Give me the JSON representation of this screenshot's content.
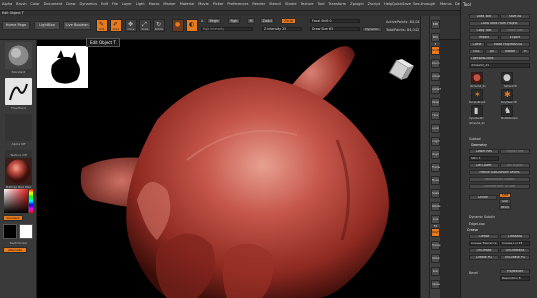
{
  "menubar": {
    "items": [
      "Alpha",
      "Brush",
      "Color",
      "Document",
      "Draw",
      "Dynamics",
      "Edit",
      "File",
      "Layer",
      "Light",
      "Macro",
      "Marker",
      "Material",
      "Movie",
      "Picker",
      "Preferences",
      "Render",
      "Stencil",
      "Stroke",
      "Texture",
      "Tool",
      "Transform",
      "Zplugin",
      "Zscript",
      "Help"
    ],
    "right": [
      "QuickSave",
      "See-through",
      "Menus",
      "DefaultZScript"
    ]
  },
  "subbar": {
    "position": "Edit Object T"
  },
  "shelf": {
    "home_page": "Home Page",
    "lightbox": "LightBox",
    "live_boolean": "Live Boolean",
    "edit": "Edit",
    "draw": "Draw",
    "move": "Move",
    "scale": "Scale",
    "rotate": "Rotate",
    "a_label": "A",
    "mrgb": "Mrgb",
    "rgb": "Rgb",
    "m": "M",
    "rgb_intensity": "Rgb Intensity",
    "zadd": "Zadd",
    "zsub": "Zsub",
    "z_intensity": "Z Intensity 25",
    "focal_shift": "Focal Shift 0",
    "draw_size": "Draw Size 63",
    "dynamic": "Dynamic",
    "active_points": "ActivePoints: 84,042",
    "total_points": "TotalPoints: 84,042"
  },
  "left": {
    "brush_name": "Standard",
    "stroke_name": "FreeHand",
    "alpha_name": "Alpha Off",
    "texture_name": "Texture Off",
    "material_name": "MatCap Red Wax",
    "gradient": "Gradient",
    "switch_color": "SwitchColor",
    "alternate": "Alternate"
  },
  "tooltip": "Edit Object  T",
  "rightstrip": {
    "buttons": [
      "BPR",
      "SPix 3",
      "Scroll",
      "Zoom",
      "Actual",
      "AAHalf",
      "Persp",
      "Floor",
      "Local",
      "L.Sym",
      "Gxyz",
      "Frame",
      "Move",
      "Scale",
      "Rotate",
      "Line Fill",
      "PolyF",
      "Transp",
      "Ghost",
      "Solo",
      "Xpose"
    ]
  },
  "palette": {
    "title": "Tool",
    "row1": [
      "Load Tool",
      "Save As"
    ],
    "row2": [
      "Load Tools From Project"
    ],
    "row3": [
      "Copy Tool",
      "Paste Tool"
    ],
    "row4": [
      "Import",
      "Export"
    ],
    "row5": [
      "Clone",
      "Make PolyMesh3D"
    ],
    "row6": [
      "GoZ",
      "All",
      "Visible",
      "R"
    ],
    "lightbox_tools": "Lightbox▸Tools",
    "dynamesh_slider": "dimesh2_41",
    "slot_names": [
      "dimesh2_41",
      "Sphere3D",
      "SimpleBrush",
      "PolyMesh3D",
      "Cylinder3D",
      "MultiMarkers",
      "dimesh2_41"
    ],
    "subtool": "Subtool",
    "geometry": "Geometry",
    "lower_res": "Lower Res",
    "higher_res": "Higher Res",
    "sdiv": "SDiv 1",
    "del_lower": "Del Lower",
    "del_higher": "Del Higher",
    "freeze": "Freeze SubDivision Levels",
    "reconstruct": "Reconstruct Subdiv",
    "convert_bpr": "Convert BPR To Geo",
    "divide": "Divide",
    "smt": "Smt",
    "suv": "Suv",
    "reuv": "ReUV",
    "dynamic_subdiv": "Dynamic Subdiv",
    "edgeloop": "EdgeLoop",
    "crease": "Crease",
    "crease_btn": "Crease",
    "crease_all": "CreaseAll",
    "crease_tol": "Crease Tolerance 45",
    "crease_lvl": "Crease Lvl 15",
    "uncrease": "UnCrease",
    "uncrease_all": "UnCreaseAll",
    "crease_pg": "Crease PG",
    "uncrease_pg": "UnCrease PG",
    "bevel": "Bevel",
    "proj_master": "ProjMaster",
    "resolution": "Resolution 8"
  }
}
